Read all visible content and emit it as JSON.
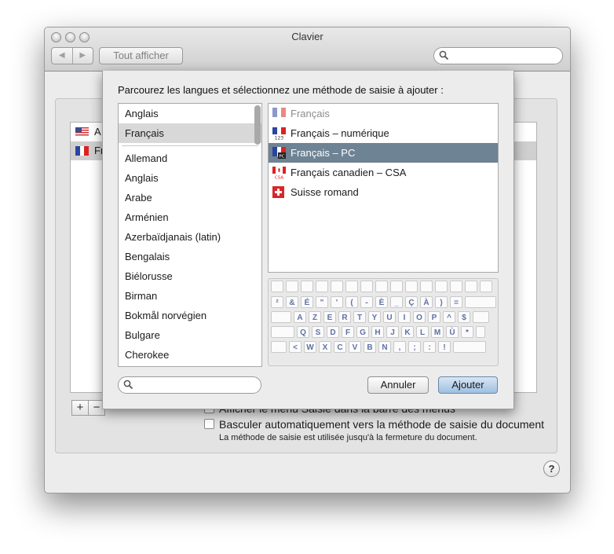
{
  "window": {
    "title": "Clavier"
  },
  "toolbar": {
    "back": "◀",
    "forward": "▶",
    "show_all": "Tout afficher",
    "search_placeholder": ""
  },
  "background_list": [
    {
      "label": "A",
      "flag": "us"
    },
    {
      "label": "Fr",
      "flag": "fr"
    }
  ],
  "add_button": "+",
  "remove_button": "−",
  "options": {
    "show_menu": "Afficher le menu Saisie dans la barre des menus",
    "auto_switch": "Basculer automatiquement vers la méthode de saisie du document",
    "auto_switch_note": "La méthode de saisie est utilisée jusqu'à la fermeture du document."
  },
  "help_label": "?",
  "sheet": {
    "prompt": "Parcourez les langues et sélectionnez une méthode de saisie à ajouter :",
    "top_languages": [
      "Anglais",
      "Français"
    ],
    "languages": [
      "Allemand",
      "Anglais",
      "Arabe",
      "Arménien",
      "Azerbaïdjanais (latin)",
      "Bengalais",
      "Biélorusse",
      "Birman",
      "Bokmål norvégien",
      "Bulgare",
      "Cherokee"
    ],
    "selected_language": "Français",
    "methods": [
      {
        "label": "Français",
        "icon": "flag-fr-icon",
        "dimmed": true
      },
      {
        "label": "Français – numérique",
        "icon": "flag-fr-123-icon"
      },
      {
        "label": "Français – PC",
        "icon": "flag-fr-pc-icon",
        "selected": true
      },
      {
        "label": "Français canadien – CSA",
        "icon": "flag-ca-csa-icon"
      },
      {
        "label": "Suisse romand",
        "icon": "flag-ch-icon"
      }
    ],
    "keyboard_rows": [
      [
        "²",
        "&",
        "É",
        "\"",
        "'",
        "(",
        "-",
        "È",
        "_",
        "Ç",
        "À",
        ")",
        "="
      ],
      [
        "A",
        "Z",
        "E",
        "R",
        "T",
        "Y",
        "U",
        "I",
        "O",
        "P",
        "^",
        "$"
      ],
      [
        "Q",
        "S",
        "D",
        "F",
        "G",
        "H",
        "J",
        "K",
        "L",
        "M",
        "Ù",
        "*"
      ],
      [
        "<",
        "W",
        "X",
        "C",
        "V",
        "B",
        "N",
        ",",
        ";",
        ":",
        "!"
      ]
    ],
    "search_placeholder": "",
    "cancel_label": "Annuler",
    "add_label": "Ajouter"
  }
}
